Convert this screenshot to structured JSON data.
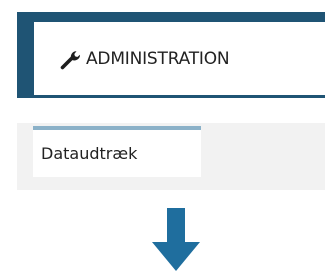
{
  "header": {
    "admin_label": "ADMINISTRATION",
    "admin_icon": "wrench-icon",
    "bar_color": "#1f5474"
  },
  "subnav": {
    "tabs": [
      {
        "label": "Dataudtræk",
        "active": true
      }
    ],
    "active_border_color": "#8bb1c8"
  },
  "indicator": {
    "icon": "arrow-down-icon",
    "color": "#1f6e9e"
  }
}
